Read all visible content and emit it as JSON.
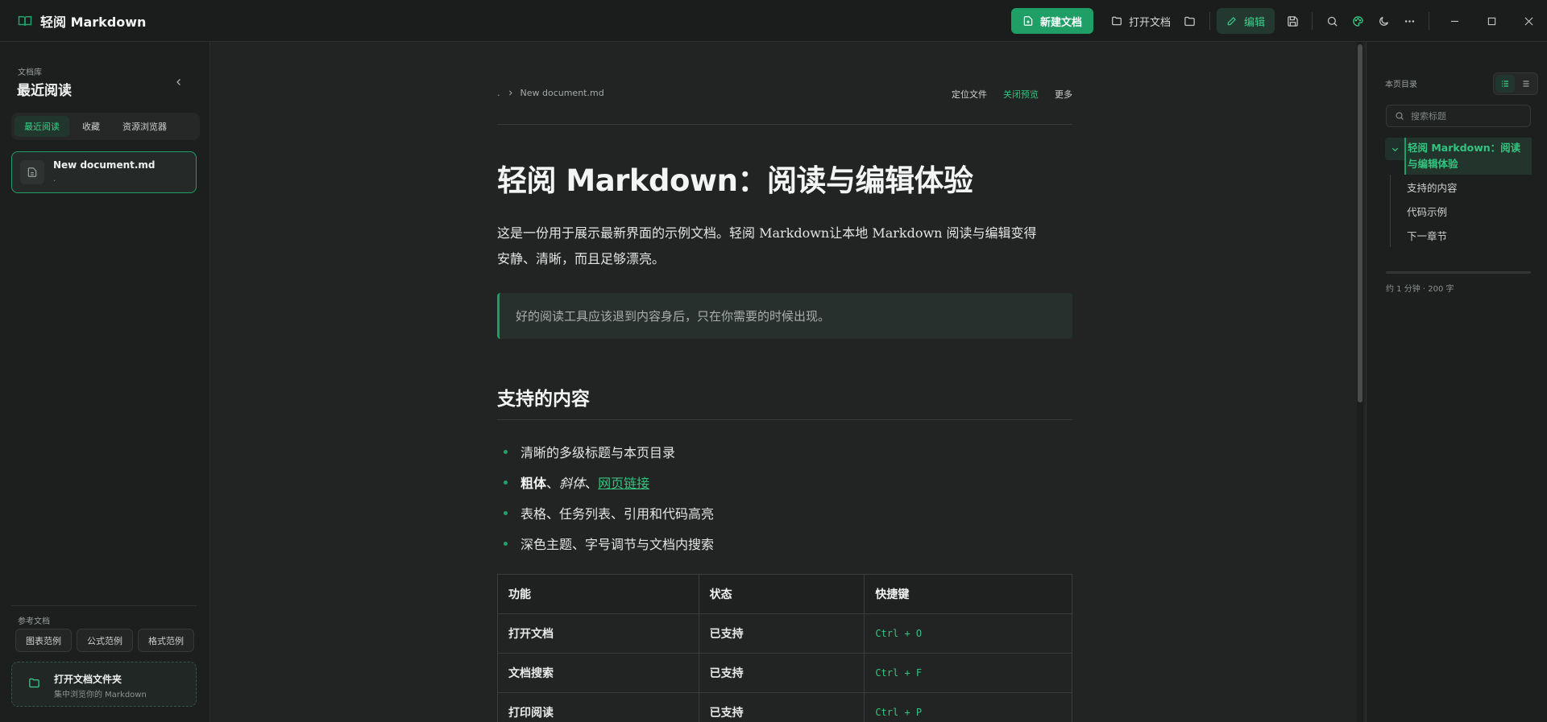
{
  "app": {
    "title": "轻阅 Markdown",
    "accent_color": "#1f9e66"
  },
  "toolbar": {
    "new_doc_label": "新建文档",
    "open_doc_label": "打开文档",
    "edit_label": "编辑"
  },
  "sidebar": {
    "library_label": "文档库",
    "title": "最近阅读",
    "tabs": [
      {
        "label": "最近阅读",
        "active": true
      },
      {
        "label": "收藏",
        "active": false
      },
      {
        "label": "资源浏览器",
        "active": false
      }
    ],
    "documents": [
      {
        "name": "New document.md",
        "sub": "."
      }
    ],
    "reference_label": "参考文档",
    "reference_buttons": [
      "图表范例",
      "公式范例",
      "格式范例"
    ],
    "open_folder": {
      "title": "打开文档文件夹",
      "subtitle": "集中浏览你的 Markdown"
    }
  },
  "document": {
    "breadcrumb": {
      "root": ".",
      "file": "New document.md"
    },
    "actions": {
      "locate": "定位文件",
      "close_preview": "关闭预览",
      "more": "更多"
    },
    "h1": "轻阅 Markdown：阅读与编辑体验",
    "paragraph_line1": "这是一份用于展示最新界面的示例文档。轻阅 Markdown让本地 Markdown 阅读与编辑变得",
    "paragraph_line2": "安静、清晰，而且足够漂亮。",
    "quote": "好的阅读工具应该退到内容身后，只在你需要的时候出现。",
    "h2": "支持的内容",
    "list": {
      "item1": "清晰的多级标题与本页目录",
      "item2_bold": "粗体",
      "item2_sep1": "、",
      "item2_italic": "斜体",
      "item2_sep2": "、",
      "item2_link": "网页链接",
      "item3": "表格、任务列表、引用和代码高亮",
      "item4": "深色主题、字号调节与文档内搜索"
    },
    "table": {
      "headers": [
        "功能",
        "状态",
        "快捷键"
      ],
      "rows": [
        [
          "打开文档",
          "已支持",
          "Ctrl + O"
        ],
        [
          "文档搜索",
          "已支持",
          "Ctrl + F"
        ],
        [
          "打印阅读",
          "已支持",
          "Ctrl + P"
        ]
      ]
    }
  },
  "toc": {
    "label": "本页目录",
    "search_placeholder": "搜索标题",
    "top_heading": "轻阅 Markdown：阅读与编辑体验",
    "children": [
      "支持的内容",
      "代码示例",
      "下一章节"
    ],
    "reading_progress": 0.0,
    "meta": "约 1 分钟 · 200 字"
  }
}
